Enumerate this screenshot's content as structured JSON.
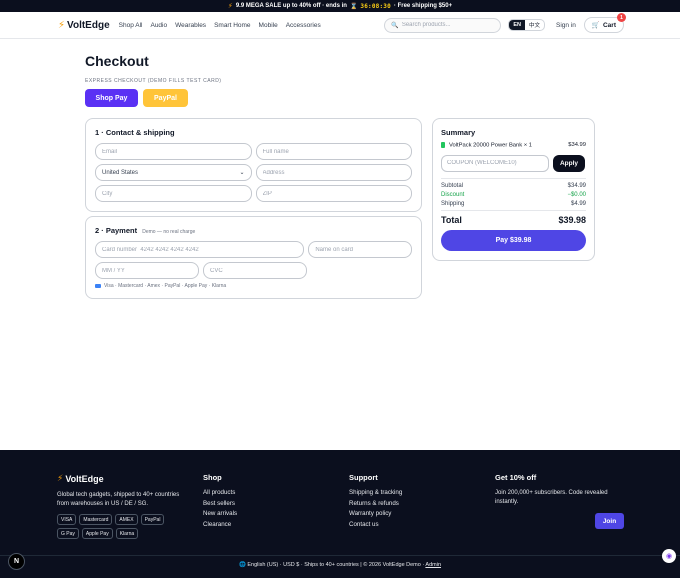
{
  "promo": {
    "text": "9.9 MEGA SALE up to 40% off · ends in",
    "hourglass": "⌛",
    "timer": "36:08:30",
    "suffix": "· Free shipping $50+"
  },
  "header": {
    "logo": "VoltEdge",
    "nav": [
      "Shop All",
      "Audio",
      "Wearables",
      "Smart Home",
      "Mobile",
      "Accessories"
    ],
    "search_placeholder": "Search products...",
    "lang_en": "EN",
    "lang_zh": "中文",
    "signin": "Sign in",
    "cart_label": "Cart",
    "cart_count": "1"
  },
  "checkout": {
    "title": "Checkout",
    "express_label": "EXPRESS CHECKOUT (DEMO FILLS TEST CARD)",
    "shop_pay": "Shop Pay",
    "paypal": "PayPal",
    "contact": {
      "heading": "1 · Contact & shipping",
      "email_ph": "Email",
      "fullname_ph": "Full name",
      "country": "United States",
      "address_ph": "Address",
      "city_ph": "City",
      "zip_ph": "ZIP"
    },
    "payment": {
      "heading": "2 · Payment",
      "note": "Demo — no real charge",
      "card_ph": "Card number  4242 4242 4242 4242",
      "name_ph": "Name on card",
      "exp_ph": "MM / YY",
      "cvc_ph": "CVC",
      "methods": "Visa · Mastercard · Amex · PayPal · Apple Pay · Klarna"
    }
  },
  "summary": {
    "heading": "Summary",
    "item_name": "VoltPack 20000 Power Bank × 1",
    "item_price": "$34.99",
    "coupon_ph": "COUPON (WELCOME10)",
    "apply": "Apply",
    "subtotal_label": "Subtotal",
    "subtotal": "$34.99",
    "discount_label": "Discount",
    "discount": "−$0.00",
    "shipping_label": "Shipping",
    "shipping": "$4.99",
    "total_label": "Total",
    "total": "$39.98",
    "pay": "Pay $39.98"
  },
  "footer": {
    "logo": "VoltEdge",
    "desc": "Global tech gadgets, shipped to 40+ countries from warehouses in US / DE / SG.",
    "chips": [
      "VISA",
      "Mastercard",
      "AMEX",
      "PayPal",
      "G Pay",
      "Apple Pay",
      "Klarna"
    ],
    "shop_heading": "Shop",
    "shop_links": [
      "All products",
      "Best sellers",
      "New arrivals",
      "Clearance"
    ],
    "support_heading": "Support",
    "support_links": [
      "Shipping & tracking",
      "Returns & refunds",
      "Warranty policy",
      "Contact us"
    ],
    "news_heading": "Get 10% off",
    "news_desc": "Join 200,000+ subscribers. Code revealed instantly.",
    "join": "Join",
    "bottom": "English (US) · USD $ · Ships to 40+ countries  |  © 2026 VoltEdge Demo ·",
    "admin": "Admin"
  },
  "icons": {
    "bolt": "⚡",
    "search": "🔍",
    "cart": "🛒",
    "globe": "🌐"
  },
  "colors": {
    "accent": "#4f46e5",
    "shop_pay": "#5a31f4",
    "paypal": "#ffc439",
    "dark": "#0b0f1e",
    "discount": "#16a34a"
  }
}
